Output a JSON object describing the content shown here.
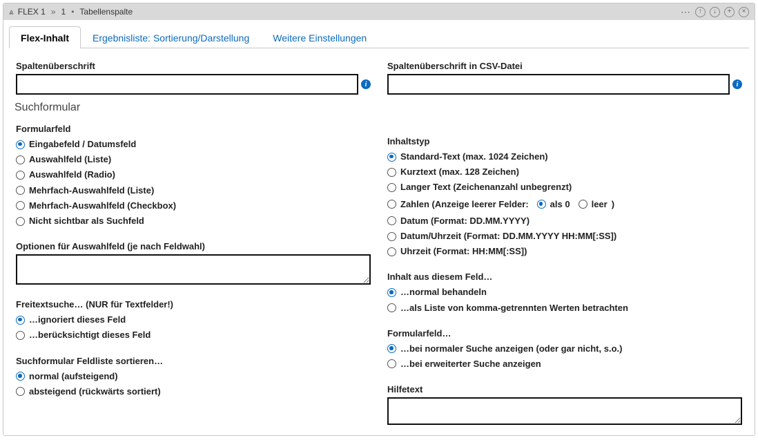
{
  "header": {
    "breadcrumb1": "FLEX 1",
    "sep": "»",
    "breadcrumb2": "1",
    "bullet": "•",
    "breadcrumb3": "Tabellenspalte"
  },
  "tabs": {
    "active": "Flex-Inhalt",
    "t2": "Ergebnisliste: Sortierung/Darstellung",
    "t3": "Weitere Einstellungen"
  },
  "left": {
    "spaltenueberschrift_label": "Spaltenüberschrift",
    "spaltenueberschrift_value": "",
    "section": "Suchformular",
    "formularfeld_label": "Formularfeld",
    "formularfeld_options": [
      "Eingabefeld / Datumsfeld",
      "Auswahlfeld (Liste)",
      "Auswahlfeld (Radio)",
      "Mehrfach-Auswahlfeld (Liste)",
      "Mehrfach-Auswahlfeld (Checkbox)",
      "Nicht sichtbar als Suchfeld"
    ],
    "optionen_label": "Optionen für Auswahlfeld (je nach Feldwahl)",
    "optionen_value": "",
    "freitext_label": "Freitextsuche… (NUR für Textfelder!)",
    "freitext_options": [
      "…ignoriert dieses Feld",
      "…berücksichtigt dieses Feld"
    ],
    "sort_label": "Suchformular Feldliste sortieren…",
    "sort_options": [
      "normal (aufsteigend)",
      "absteigend (rückwärts sortiert)"
    ]
  },
  "right": {
    "csv_label": "Spaltenüberschrift in CSV-Datei",
    "csv_value": "",
    "inhaltstyp_label": "Inhaltstyp",
    "inhaltstyp_r0": "Standard-Text (max. 1024 Zeichen)",
    "inhaltstyp_r1": "Kurztext (max. 128 Zeichen)",
    "inhaltstyp_r2": "Langer Text (Zeichenanzahl unbegrenzt)",
    "inhaltstyp_r3_prefix": "Zahlen (Anzeige leerer Felder:",
    "inhaltstyp_r3_opt_a": "als 0",
    "inhaltstyp_r3_opt_b": "leer",
    "inhaltstyp_r3_suffix": ")",
    "inhaltstyp_r4": "Datum (Format: DD.MM.YYYY)",
    "inhaltstyp_r5": "Datum/Uhrzeit (Format: DD.MM.YYYY HH:MM[:SS])",
    "inhaltstyp_r6": "Uhrzeit (Format: HH:MM[:SS])",
    "inhalt_feld_label": "Inhalt aus diesem Feld…",
    "inhalt_feld_options": [
      "…normal behandeln",
      "…als Liste von komma-getrennten Werten betrachten"
    ],
    "formularfeld2_label": "Formularfeld…",
    "formularfeld2_options": [
      "…bei normaler Suche anzeigen (oder gar nicht, s.o.)",
      "…bei erweiterter Suche anzeigen"
    ],
    "hilfetext_label": "Hilfetext",
    "hilfetext_value": ""
  }
}
